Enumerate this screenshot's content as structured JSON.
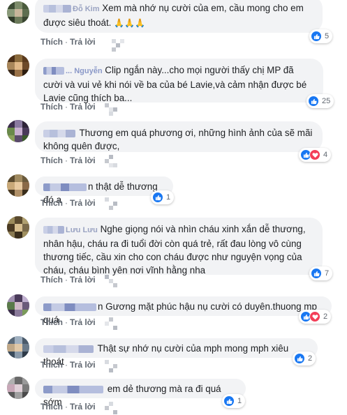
{
  "actions": {
    "like": "Thích",
    "reply": "Trả lời",
    "sep": "·"
  },
  "colors": {
    "like": "#1877f2",
    "love": "#f33e58",
    "bubble": "#f2f3f5"
  },
  "comments": [
    {
      "name": "Đỗ Kim",
      "text": "Xem mà nhớ nụ cười của em, cầu mong cho em được siêu thoát.",
      "emoji": "🙏🙏🙏",
      "reactions": "5",
      "icons": [
        "like-icon"
      ]
    },
    {
      "name": "... Nguyễn",
      "text": "Clip ngắn này...cho mọi người thấy chị MP đã cười và vui vẻ khi nói về ba của bé Lavie,và cảm nhận được bé Lavie cũng thích ba...",
      "reactions": "25",
      "icons": [
        "like-icon"
      ]
    },
    {
      "name": "",
      "text": "Thương em quá phương ơi, những hình ảnh của sẽ mãi không quên được,",
      "reactions": "4",
      "icons": [
        "like-icon",
        "love-icon"
      ]
    },
    {
      "name": "",
      "text": "n thật dễ thương đó a",
      "reactions": "1",
      "icons": [
        "like-icon"
      ]
    },
    {
      "name": "Lưu Lưu",
      "text": "Nghe giọng nói và nhìn cháu xinh xắn dễ thương, nhân hậu, cháu ra đi tuổi đời còn quá trẻ, rất đau lòng vô cùng thương tiếc, cầu xin cho con cháu được như nguyện vọng của cháu, cháu bình yên nơi vĩnh hằng nha",
      "reactions": "7",
      "icons": [
        "like-icon"
      ]
    },
    {
      "name": "",
      "text": "n Gương mặt phúc hậu nụ cười có duyên.thuong mp quá",
      "reactions": "2",
      "icons": [
        "like-icon",
        "love-icon"
      ]
    },
    {
      "name": "",
      "text": "Thật sự nhớ nụ cười của mph mong mph xiêu thoát",
      "reactions": "2",
      "icons": [
        "like-icon"
      ]
    },
    {
      "name": "",
      "text": "em dẻ thương mà ra đi quá sớm",
      "reactions": "1",
      "icons": [
        "like-icon"
      ]
    }
  ]
}
